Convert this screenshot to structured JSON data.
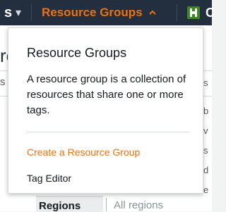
{
  "topbar": {
    "left_label": "s",
    "resource_groups_label": "Resource Groups",
    "service_label": "C",
    "icons": {
      "left_caret": "chevron-down-icon",
      "rg_caret": "chevron-up-icon",
      "service": "service-cube-icon"
    }
  },
  "background": {
    "heading_fragment": "re",
    "text_fragment": "s a",
    "right_fragment_1": "s",
    "right_fragment_2": "b",
    "right_fragment_3": "v",
    "right_fragment_4": "s",
    "right_fragment_5": "d",
    "right_fragment_6": "e",
    "bottom_tab_label": "Regions",
    "bottom_all_label": "All regions"
  },
  "dropdown": {
    "title": "Resource Groups",
    "description": "A resource group is a collection of resources that share one or more tags.",
    "create_link": "Create a Resource Group",
    "tag_editor": "Tag Editor"
  },
  "colors": {
    "topbar_bg": "#232f3e",
    "accent_orange": "#ec7211",
    "service_green": "#3f8624",
    "text_dark": "#16191f"
  }
}
